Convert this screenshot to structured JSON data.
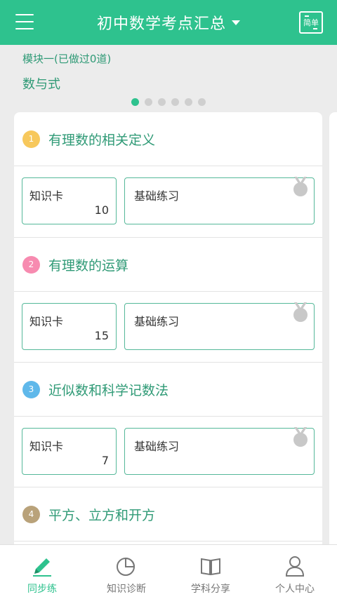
{
  "header": {
    "title": "初中数学考点汇总",
    "simple_label": "简单"
  },
  "module": {
    "subtitle": "模块一(已做过0道)",
    "name": "数与式"
  },
  "carousel": {
    "count": 6,
    "active": 0
  },
  "topics": [
    {
      "index": "1",
      "title": "有理数的相关定义",
      "color": "#f7c85c",
      "card_label": "知识卡",
      "card_count": "10",
      "practice_label": "基础练习"
    },
    {
      "index": "2",
      "title": "有理数的运算",
      "color": "#f78bb0",
      "card_label": "知识卡",
      "card_count": "15",
      "practice_label": "基础练习"
    },
    {
      "index": "3",
      "title": "近似数和科学记数法",
      "color": "#5fb8ea",
      "card_label": "知识卡",
      "card_count": "7",
      "practice_label": "基础练习"
    },
    {
      "index": "4",
      "title": "平方、立方和开方",
      "color": "#b9a27a"
    }
  ],
  "tabs": [
    {
      "label": "同步练",
      "icon": "pencil-icon",
      "active": true
    },
    {
      "label": "知识诊断",
      "icon": "pie-chart-icon",
      "active": false
    },
    {
      "label": "学科分享",
      "icon": "book-icon",
      "active": false
    },
    {
      "label": "个人中心",
      "icon": "user-icon",
      "active": false
    }
  ],
  "colors": {
    "brand": "#2ec28e",
    "text_green": "#2f9a76"
  }
}
